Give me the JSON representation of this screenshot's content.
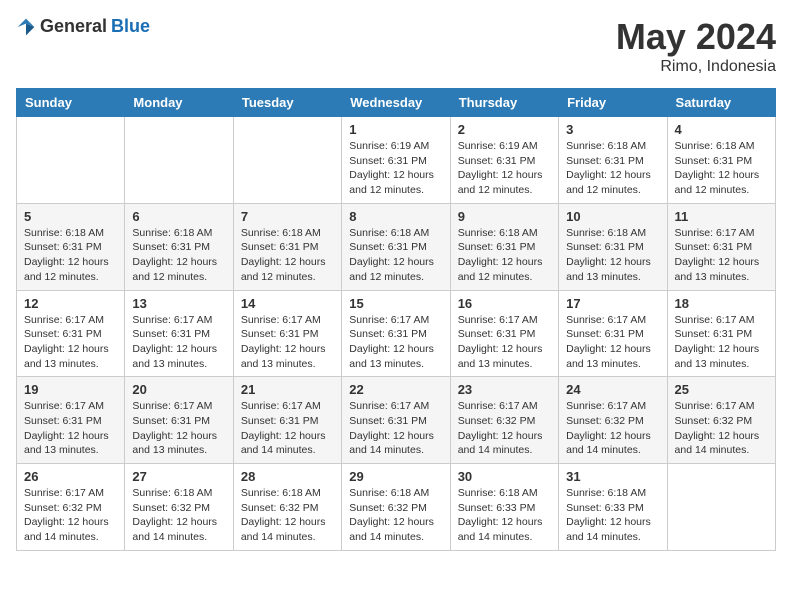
{
  "header": {
    "logo_general": "General",
    "logo_blue": "Blue",
    "month_year": "May 2024",
    "location": "Rimo, Indonesia"
  },
  "weekdays": [
    "Sunday",
    "Monday",
    "Tuesday",
    "Wednesday",
    "Thursday",
    "Friday",
    "Saturday"
  ],
  "weeks": [
    [
      {
        "day": "",
        "info": ""
      },
      {
        "day": "",
        "info": ""
      },
      {
        "day": "",
        "info": ""
      },
      {
        "day": "1",
        "info": "Sunrise: 6:19 AM\nSunset: 6:31 PM\nDaylight: 12 hours\nand 12 minutes."
      },
      {
        "day": "2",
        "info": "Sunrise: 6:19 AM\nSunset: 6:31 PM\nDaylight: 12 hours\nand 12 minutes."
      },
      {
        "day": "3",
        "info": "Sunrise: 6:18 AM\nSunset: 6:31 PM\nDaylight: 12 hours\nand 12 minutes."
      },
      {
        "day": "4",
        "info": "Sunrise: 6:18 AM\nSunset: 6:31 PM\nDaylight: 12 hours\nand 12 minutes."
      }
    ],
    [
      {
        "day": "5",
        "info": "Sunrise: 6:18 AM\nSunset: 6:31 PM\nDaylight: 12 hours\nand 12 minutes."
      },
      {
        "day": "6",
        "info": "Sunrise: 6:18 AM\nSunset: 6:31 PM\nDaylight: 12 hours\nand 12 minutes."
      },
      {
        "day": "7",
        "info": "Sunrise: 6:18 AM\nSunset: 6:31 PM\nDaylight: 12 hours\nand 12 minutes."
      },
      {
        "day": "8",
        "info": "Sunrise: 6:18 AM\nSunset: 6:31 PM\nDaylight: 12 hours\nand 12 minutes."
      },
      {
        "day": "9",
        "info": "Sunrise: 6:18 AM\nSunset: 6:31 PM\nDaylight: 12 hours\nand 12 minutes."
      },
      {
        "day": "10",
        "info": "Sunrise: 6:18 AM\nSunset: 6:31 PM\nDaylight: 12 hours\nand 13 minutes."
      },
      {
        "day": "11",
        "info": "Sunrise: 6:17 AM\nSunset: 6:31 PM\nDaylight: 12 hours\nand 13 minutes."
      }
    ],
    [
      {
        "day": "12",
        "info": "Sunrise: 6:17 AM\nSunset: 6:31 PM\nDaylight: 12 hours\nand 13 minutes."
      },
      {
        "day": "13",
        "info": "Sunrise: 6:17 AM\nSunset: 6:31 PM\nDaylight: 12 hours\nand 13 minutes."
      },
      {
        "day": "14",
        "info": "Sunrise: 6:17 AM\nSunset: 6:31 PM\nDaylight: 12 hours\nand 13 minutes."
      },
      {
        "day": "15",
        "info": "Sunrise: 6:17 AM\nSunset: 6:31 PM\nDaylight: 12 hours\nand 13 minutes."
      },
      {
        "day": "16",
        "info": "Sunrise: 6:17 AM\nSunset: 6:31 PM\nDaylight: 12 hours\nand 13 minutes."
      },
      {
        "day": "17",
        "info": "Sunrise: 6:17 AM\nSunset: 6:31 PM\nDaylight: 12 hours\nand 13 minutes."
      },
      {
        "day": "18",
        "info": "Sunrise: 6:17 AM\nSunset: 6:31 PM\nDaylight: 12 hours\nand 13 minutes."
      }
    ],
    [
      {
        "day": "19",
        "info": "Sunrise: 6:17 AM\nSunset: 6:31 PM\nDaylight: 12 hours\nand 13 minutes."
      },
      {
        "day": "20",
        "info": "Sunrise: 6:17 AM\nSunset: 6:31 PM\nDaylight: 12 hours\nand 13 minutes."
      },
      {
        "day": "21",
        "info": "Sunrise: 6:17 AM\nSunset: 6:31 PM\nDaylight: 12 hours\nand 14 minutes."
      },
      {
        "day": "22",
        "info": "Sunrise: 6:17 AM\nSunset: 6:31 PM\nDaylight: 12 hours\nand 14 minutes."
      },
      {
        "day": "23",
        "info": "Sunrise: 6:17 AM\nSunset: 6:32 PM\nDaylight: 12 hours\nand 14 minutes."
      },
      {
        "day": "24",
        "info": "Sunrise: 6:17 AM\nSunset: 6:32 PM\nDaylight: 12 hours\nand 14 minutes."
      },
      {
        "day": "25",
        "info": "Sunrise: 6:17 AM\nSunset: 6:32 PM\nDaylight: 12 hours\nand 14 minutes."
      }
    ],
    [
      {
        "day": "26",
        "info": "Sunrise: 6:17 AM\nSunset: 6:32 PM\nDaylight: 12 hours\nand 14 minutes."
      },
      {
        "day": "27",
        "info": "Sunrise: 6:18 AM\nSunset: 6:32 PM\nDaylight: 12 hours\nand 14 minutes."
      },
      {
        "day": "28",
        "info": "Sunrise: 6:18 AM\nSunset: 6:32 PM\nDaylight: 12 hours\nand 14 minutes."
      },
      {
        "day": "29",
        "info": "Sunrise: 6:18 AM\nSunset: 6:32 PM\nDaylight: 12 hours\nand 14 minutes."
      },
      {
        "day": "30",
        "info": "Sunrise: 6:18 AM\nSunset: 6:33 PM\nDaylight: 12 hours\nand 14 minutes."
      },
      {
        "day": "31",
        "info": "Sunrise: 6:18 AM\nSunset: 6:33 PM\nDaylight: 12 hours\nand 14 minutes."
      },
      {
        "day": "",
        "info": ""
      }
    ]
  ]
}
